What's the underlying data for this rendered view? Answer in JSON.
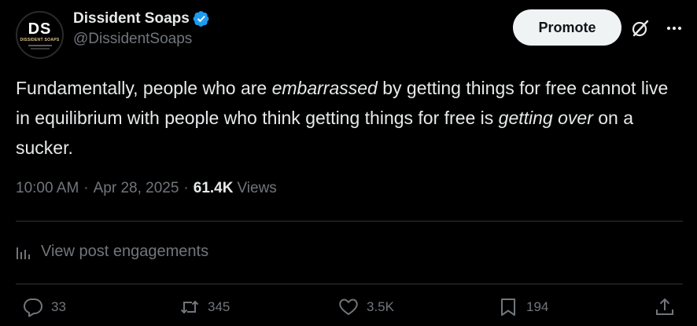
{
  "author": {
    "avatar_monogram": "DS",
    "avatar_brand": "DISSIDENT SOAPS",
    "display_name": "Dissident Soaps",
    "handle": "@DissidentSoaps",
    "verified_color": "#1d9bf0"
  },
  "header_actions": {
    "promote_label": "Promote",
    "grok_icon": "grok-icon",
    "more_icon": "more-icon"
  },
  "tweet": {
    "seg1": "Fundamentally, people who are ",
    "seg2_italic": "embarrassed",
    "seg3": " by getting things for free cannot live in equilibrium with people who think getting things for free is ",
    "seg4_italic": "getting over",
    "seg5": " on a sucker."
  },
  "meta": {
    "time": "10:00 AM",
    "separator": "·",
    "date": "Apr 28, 2025",
    "views_count": "61.4K",
    "views_label": "Views"
  },
  "engagements": {
    "label": "View post engagements",
    "icon": "analytics-icon"
  },
  "actions": {
    "replies": "33",
    "reposts": "345",
    "likes": "3.5K",
    "bookmarks": "194"
  },
  "colors": {
    "background": "#000000",
    "text": "#e7e9ea",
    "muted": "#71767b",
    "divider": "#2f3336",
    "button_bg": "#eff3f4"
  }
}
